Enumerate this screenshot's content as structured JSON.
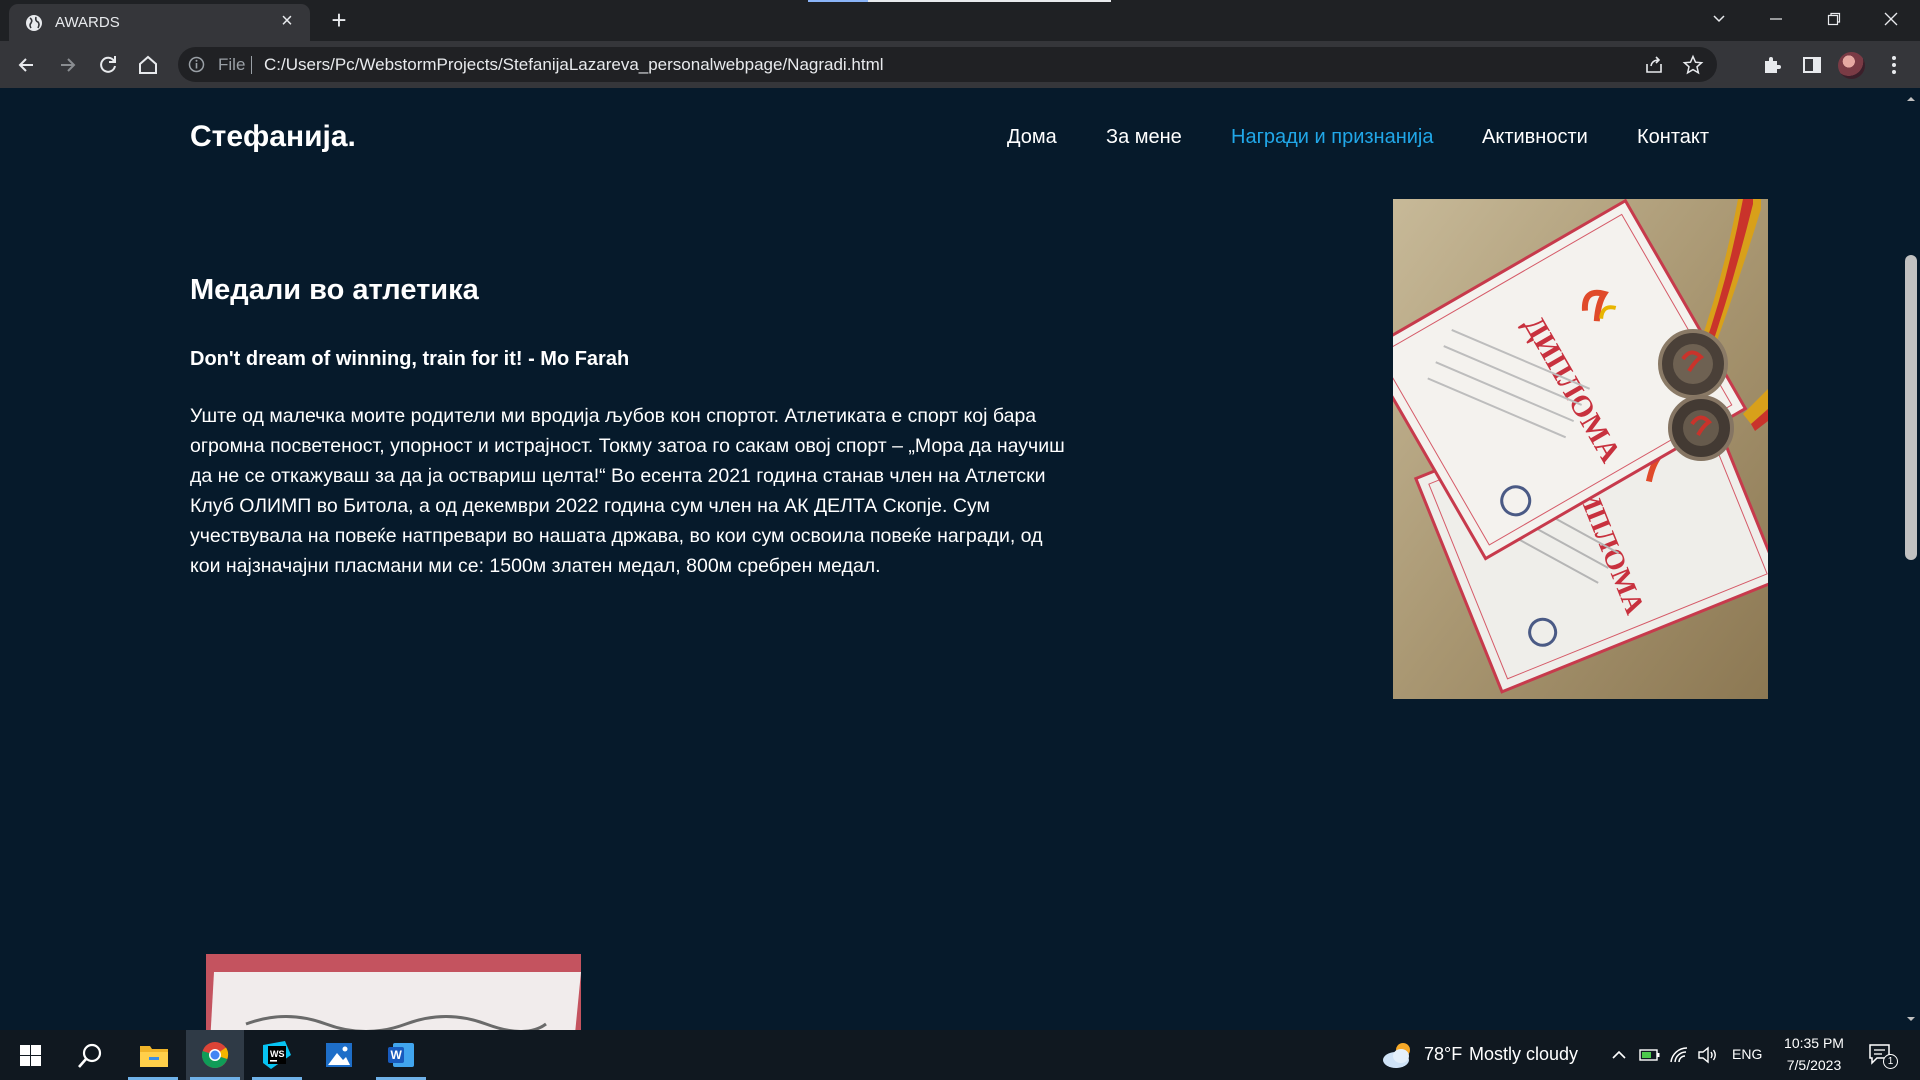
{
  "browser": {
    "tab_title": "AWARDS",
    "tab_favicon": "globe-icon",
    "omnibox": {
      "scheme_label": "File",
      "url": "C:/Users/Pc/WebstormProjects/StefanijaLazareva_personalwebpage/Nagradi.html"
    }
  },
  "page": {
    "brand": "Стефанија.",
    "nav": [
      {
        "label": "Дома",
        "active": false
      },
      {
        "label": "За мене",
        "active": false
      },
      {
        "label": "Награди и признанија",
        "active": true
      },
      {
        "label": "Активности",
        "active": false
      },
      {
        "label": "Контакт",
        "active": false
      }
    ],
    "section": {
      "title": "Медали во атлетика",
      "quote": "Don't dream of winning, train for it! - Mo Farah",
      "body": "Уште од малечка моите родители ми вродија љубов кон спортот. Атлетиката е спорт кој бара огромна посветеност, упорност и истрајност. Токму затоа го сакам овој спорт – „Мора да научиш да не се откажуваш за да ја оствариш целта!“ Во есента 2021 година станав член на Атлетски Клуб ОЛИМП во Битола, а од декември 2022 година сум член на АК ДЕЛТА Скопје. Сум учествувала на повеќе натпревари во нашата држава, во кои сум освоила повеќе награди, од кои најзначајни пласмани ми се: 1500м златен медал, 800м сребрен медал."
    },
    "photos": {
      "diploma_word": "ДИПЛОМА"
    },
    "colors": {
      "background": "#061a2b",
      "nav_active": "#21a7e8",
      "text": "#ffffff"
    }
  },
  "taskbar": {
    "weather": {
      "temp": "78°F",
      "condition": "Mostly cloudy",
      "icon": "cloud-sun-icon"
    },
    "language": "ENG",
    "time": "10:35 PM",
    "date": "7/5/2023",
    "notification_count": "1",
    "apps": [
      "windows-start-icon",
      "search-icon",
      "file-explorer-icon",
      "chrome-icon",
      "webstorm-icon",
      "photos-icon",
      "word-icon"
    ]
  }
}
